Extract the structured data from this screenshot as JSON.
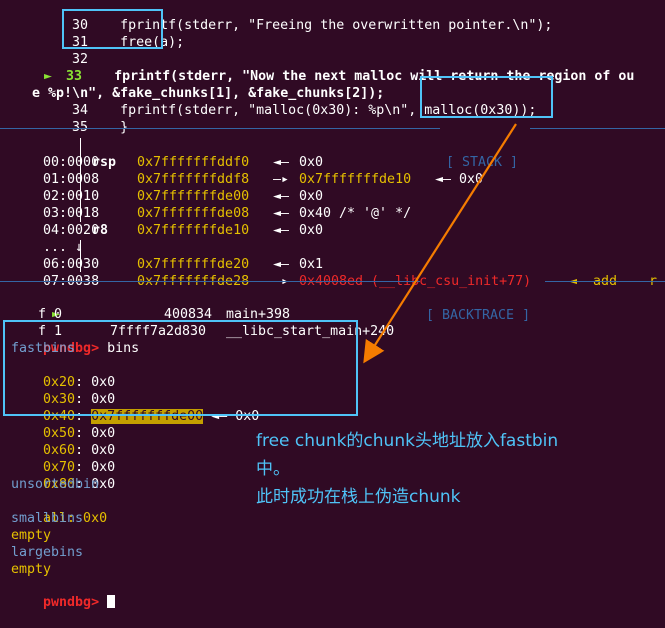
{
  "source": {
    "lines": [
      {
        "num": "30",
        "marker": "",
        "code": "fprintf(stderr, \"Freeing the overwritten pointer.\\n\");"
      },
      {
        "num": "31",
        "marker": "",
        "code": "free(a);"
      },
      {
        "num": "32",
        "marker": "",
        "code": ""
      },
      {
        "num": "33",
        "marker": "►",
        "code": "fprintf(stderr, \"Now the next malloc will return the region of ou"
      },
      {
        "num": "",
        "marker": "",
        "code": "e %p!\\n\", &fake_chunks[1], &fake_chunks[2]);"
      },
      {
        "num": "34",
        "marker": "",
        "code": "fprintf(stderr, \"malloc(0x30): %p\\n\", malloc(0x30));"
      },
      {
        "num": "35",
        "marker": "",
        "code": "}"
      }
    ]
  },
  "stack": {
    "header": "[ STACK ]",
    "rows": [
      {
        "offset": "00:0000",
        "reg": "rsp",
        "addr": "0x7fffffffddf0",
        "arrow": "◄—",
        "value": "0x0",
        "extra": ""
      },
      {
        "offset": "01:0008",
        "reg": "",
        "addr": "0x7fffffffddf8",
        "arrow": "—▸",
        "value": "0x7fffffffde10",
        "extra": "◄— 0x0"
      },
      {
        "offset": "02:0010",
        "reg": "",
        "addr": "0x7fffffffde00",
        "arrow": "◄—",
        "value": "0x0",
        "extra": ""
      },
      {
        "offset": "03:0018",
        "reg": "",
        "addr": "0x7fffffffde08",
        "arrow": "◄—",
        "value": "0x40 /* '@' */",
        "extra": ""
      },
      {
        "offset": "04:0020",
        "reg": "r8",
        "addr": "0x7fffffffde10",
        "arrow": "◄—",
        "value": "0x0",
        "extra": ""
      },
      {
        "offset": "... ↓",
        "reg": "",
        "addr": "",
        "arrow": "",
        "value": "",
        "extra": ""
      },
      {
        "offset": "06:0030",
        "reg": "",
        "addr": "0x7fffffffde20",
        "arrow": "◄—",
        "value": "0x1",
        "extra": ""
      },
      {
        "offset": "07:0038",
        "reg": "",
        "addr": "0x7fffffffde28",
        "arrow": "—▸",
        "value": "0x4008ed (__libc_csu_init+77)",
        "extra": "◄— add    r"
      }
    ]
  },
  "backtrace": {
    "header": "[ BACKTRACE ]",
    "frames": [
      {
        "marker": "►",
        "label": "f 0",
        "addr": "400834",
        "sym": "main+398"
      },
      {
        "marker": "",
        "label": "f 1",
        "addr": "7ffff7a2d830",
        "sym": "__libc_start_main+240"
      }
    ]
  },
  "prompt": "pwndbg>",
  "command": "bins",
  "bins": {
    "fastbins_label": "fastbins",
    "fastbins": [
      {
        "size": "0x20",
        "value": "0x0",
        "highlight": false,
        "chain": ""
      },
      {
        "size": "0x30",
        "value": "0x0",
        "highlight": false,
        "chain": ""
      },
      {
        "size": "0x40",
        "value": "0x7fffffffde00",
        "highlight": true,
        "chain": "◄— 0x0"
      },
      {
        "size": "0x50",
        "value": "0x0",
        "highlight": false,
        "chain": ""
      },
      {
        "size": "0x60",
        "value": "0x0",
        "highlight": false,
        "chain": ""
      },
      {
        "size": "0x70",
        "value": "0x0",
        "highlight": false,
        "chain": ""
      },
      {
        "size": "0x80",
        "value": "0x0",
        "highlight": false,
        "chain": ""
      }
    ],
    "unsortedbin_label": "unsortedbin",
    "unsorted_all": "all: 0x0",
    "smallbins_label": "smallbins",
    "smallbins_value": "empty",
    "largebins_label": "largebins",
    "largebins_value": "empty"
  },
  "annotation": {
    "line1": "free chunk的chunk头地址放入fastbin",
    "line2": "中。",
    "line3": "此时成功在栈上伪造chunk"
  },
  "colors": {
    "background": "#300a24",
    "annotation_box": "#4fc3f7",
    "arrow": "#f57c00",
    "address_yellow": "#e5c000",
    "separator_blue": "#3465a4"
  }
}
